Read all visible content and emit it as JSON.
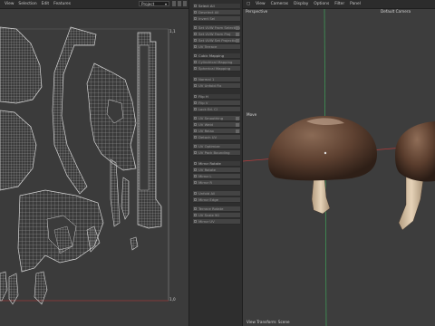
{
  "uv_editor": {
    "menu": [
      "View",
      "Selection",
      "Edit",
      "Features"
    ],
    "mode_select": "Project",
    "top_right_label": "1,1",
    "bottom_right_label": "1,0"
  },
  "mid_panel": {
    "rows": [
      "Select All",
      "Deselect All",
      "Invert Sel",
      "Set UVW From Selection",
      "Set UVW From Proj",
      "Set UVW Set Projection",
      "UV Terrace",
      "Cubic Mapping",
      "Cylindrical Mapping",
      "Spherical Mapping",
      "Normal 1",
      "UV Unfold Fix",
      "Flip H",
      "Flip V",
      "Lock Ed. Cl",
      "UV Smoothing",
      "UV Weld",
      "UV Relax",
      "Detach UV",
      "UV Optimize",
      "UV Pack Bounding",
      "Mirror Rotate",
      "UV Rotate",
      "Mirror L",
      "Mirror R",
      "Unfold All",
      "Mirror Edge",
      "Terrace Rotate",
      "UV Scale 90",
      "Mirror UV"
    ]
  },
  "viewport": {
    "menu": [
      "View",
      "Cameras",
      "Display",
      "Options",
      "Filter",
      "Panel"
    ],
    "perspective_label": "Perspective",
    "camera_label": "Default Camera",
    "tool_label": "Move",
    "status": "View Transform: Scene"
  },
  "colors": {
    "uv_wire": "#cfcfcf",
    "axis_red": "#b73b3b",
    "axis_green": "#3fa35a",
    "mushroom_cap": "#6b4a36",
    "mushroom_stem": "#d9c2a3"
  }
}
